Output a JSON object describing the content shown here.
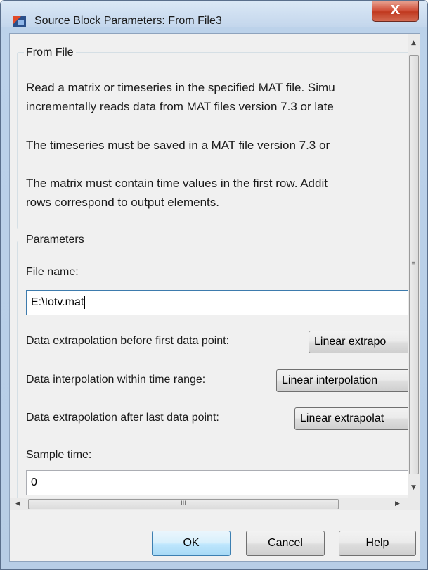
{
  "window": {
    "title": "Source Block Parameters: From File3",
    "close_label": "X"
  },
  "from_file": {
    "group_label": "From File",
    "description_lines": [
      "Read a matrix or timeseries in the specified MAT file. Simu",
      "incrementally reads data from MAT files version 7.3 or late",
      "The timeseries must be saved in a MAT file version 7.3 or",
      "The matrix must contain time values in the first row. Addit",
      "rows correspond to output elements."
    ]
  },
  "parameters": {
    "group_label": "Parameters",
    "file_name_label": "File name:",
    "file_name_value": "E:\\Iotv.mat",
    "extrap_before_label": "Data extrapolation before first data point:",
    "extrap_before_value": "Linear extrapo",
    "interp_label": "Data interpolation within time range:",
    "interp_value": "Linear interpolation",
    "extrap_after_label": "Data extrapolation after last data point:",
    "extrap_after_value": "Linear extrapolat",
    "sample_time_label": "Sample time:",
    "sample_time_value": "0"
  },
  "scrollbar": {
    "hthumb_grip": "III",
    "up_icon": "up-arrow-icon",
    "down_icon": "down-arrow-icon",
    "left_icon": "left-arrow-icon",
    "right_icon": "right-arrow-icon"
  },
  "buttons": {
    "ok": "OK",
    "cancel": "Cancel",
    "help": "Help"
  },
  "colors": {
    "close_button": "#c0391f",
    "dialog_bg": "#f0f0f0",
    "title_bar": "#c3d6ec"
  }
}
